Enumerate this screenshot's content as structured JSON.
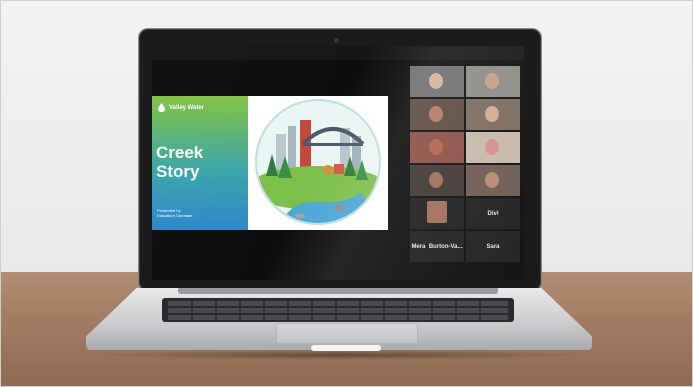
{
  "slide": {
    "brand": "Valley Water",
    "title_line1": "Creek",
    "title_line2": "Story",
    "presented_line1": "Presented by",
    "presented_line2": "Education Outreach"
  },
  "gallery": {
    "names": [
      "Divi",
      "Mera",
      "Burton-Va...",
      "Sara"
    ]
  },
  "colors": {
    "slide_green": "#82c341",
    "slide_blue": "#2f86cc",
    "screen_bg": "#0d0d0d"
  }
}
